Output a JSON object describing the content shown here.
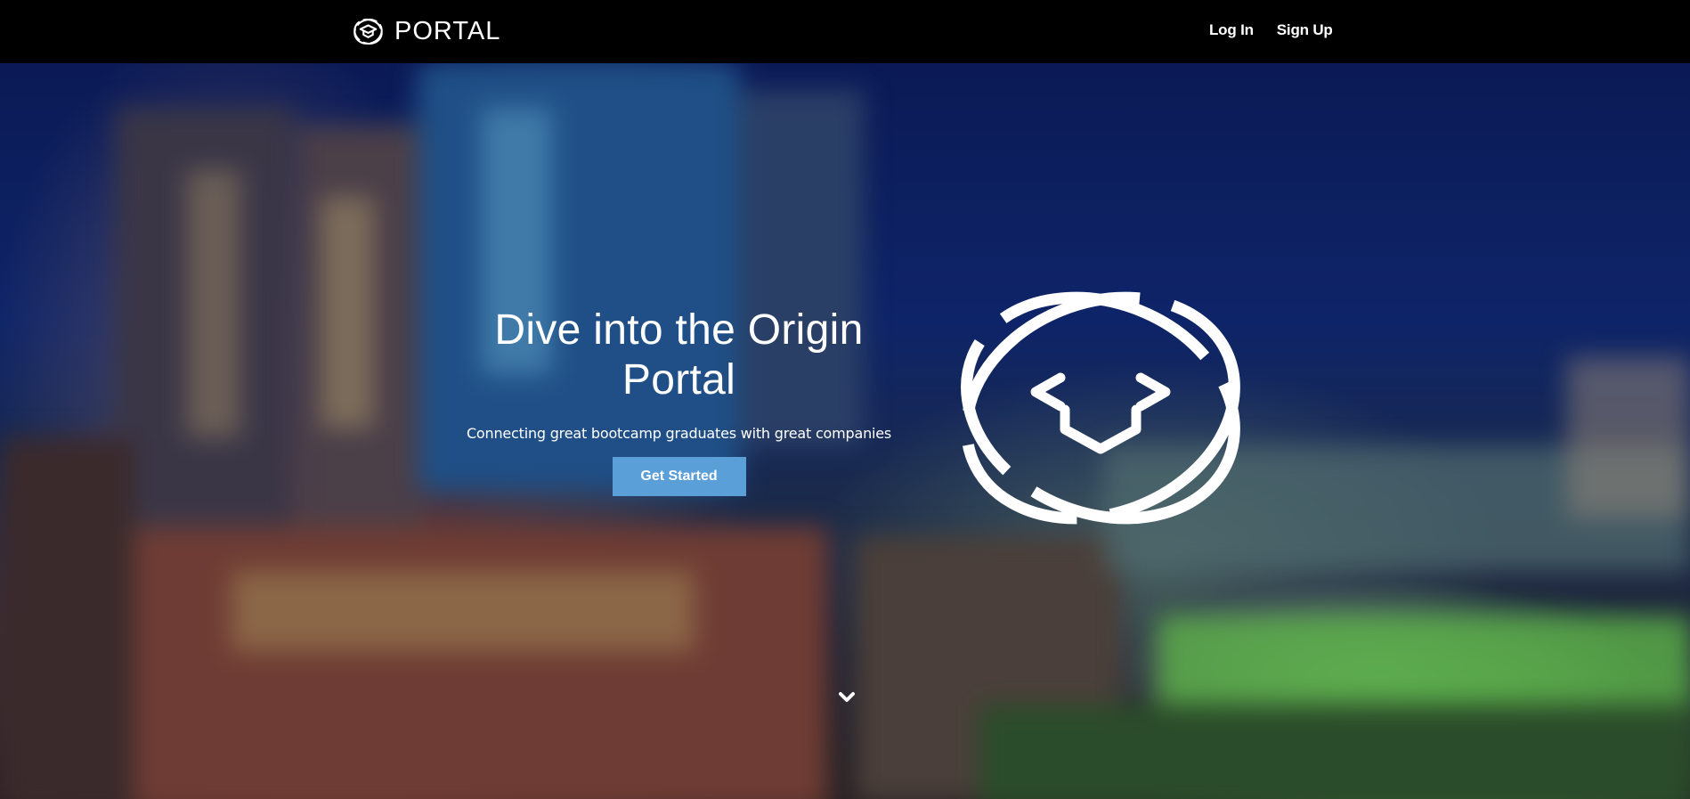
{
  "nav": {
    "brand": "PORTAL",
    "brand_icon": "graduation-cap-orbit-icon",
    "links": [
      {
        "label": "Log In"
      },
      {
        "label": "Sign Up"
      }
    ]
  },
  "hero": {
    "title": "Dive into the Origin Portal",
    "subtitle": "Connecting great bootcamp graduates with great companies",
    "cta_label": "Get Started",
    "logo_icon": "graduation-cap-orbit-icon",
    "scroll_icon": "chevron-down-icon"
  },
  "colors": {
    "navbar_bg": "#000000",
    "cta_bg": "#5b9fd8",
    "text": "#ffffff"
  }
}
